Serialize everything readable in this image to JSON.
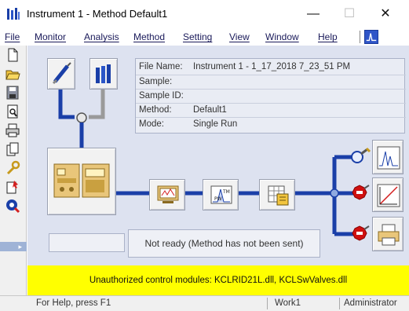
{
  "window": {
    "title": "Instrument 1 - Method  Default1",
    "min_symbol": "—",
    "max_symbol": "☐",
    "close_symbol": "✕"
  },
  "menu": {
    "items": [
      "File",
      "Monitor",
      "Analysis",
      "Method",
      "Setting",
      "View",
      "Window",
      "Help"
    ]
  },
  "toolbar": {
    "icons": [
      "new-icon",
      "open-icon",
      "save-icon",
      "preview-icon",
      "print-icon",
      "copy-icon",
      "wrench-icon",
      "run-icon",
      "find-icon"
    ],
    "more_symbol": "▸"
  },
  "info": {
    "rows": [
      {
        "key": "File Name:",
        "value": "Instrument 1 - 1_17_2018 7_23_51 PM"
      },
      {
        "key": "Sample:",
        "value": ""
      },
      {
        "key": "Sample ID:",
        "value": ""
      },
      {
        "key": "Method:",
        "value": "Default1"
      },
      {
        "key": "Mode:",
        "value": "Single Run"
      }
    ]
  },
  "status": {
    "message": "Not ready (Method has not been sent)"
  },
  "warning": {
    "text": "Unauthorized control modules: KCLRID21L.dll, KCLSwValves.dll"
  },
  "statusbar": {
    "help": "For Help, press F1",
    "work": "Work1",
    "user": "Administrator"
  },
  "colors": {
    "pipe": "#1a3fa8",
    "stop": "#d01010",
    "warning_bg": "#ffff00",
    "canvas_bg": "#dde2f0"
  }
}
